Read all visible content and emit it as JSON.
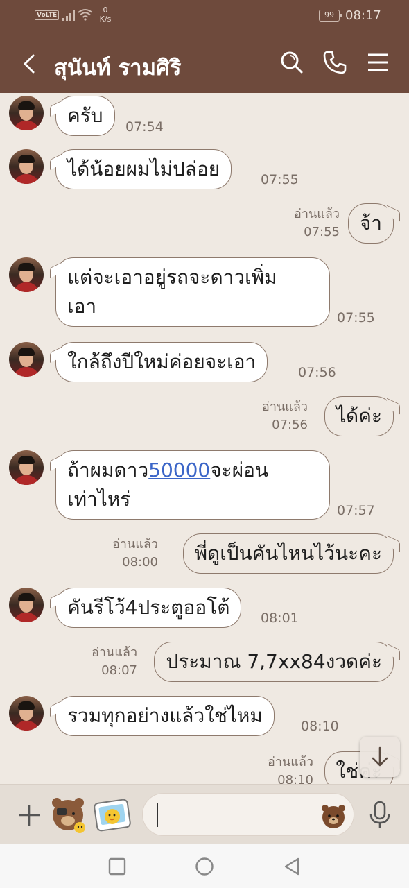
{
  "status_bar": {
    "volte": "VoLTE",
    "speed_value": "0",
    "speed_unit": "K/s",
    "battery": "99",
    "time": "08:17"
  },
  "header": {
    "title": "สุนันท์ รามศิริ",
    "icons": [
      "back-icon",
      "search-icon",
      "phone-icon",
      "menu-icon"
    ]
  },
  "messages": [
    {
      "side": "in",
      "text": "ครับ",
      "time": "07:54"
    },
    {
      "side": "in",
      "text": "ได้น้อยผมไม่ปล่อย",
      "time": "07:55"
    },
    {
      "side": "out",
      "text": "จ้า",
      "read": "อ่านแล้ว",
      "time": "07:55"
    },
    {
      "side": "in",
      "line1": "แต่จะเอาอยู่รถจะดาวเพิ่ม",
      "line2": "เอา",
      "time": "07:55"
    },
    {
      "side": "in",
      "text": "ใกล้ถึงปีใหม่ค่อยจะเอา",
      "time": "07:56"
    },
    {
      "side": "out",
      "text": "ได้ค่ะ",
      "read": "อ่านแล้ว",
      "time": "07:56"
    },
    {
      "side": "in",
      "pre": "ถ้าผมดาว",
      "link": "50000",
      "post": "จะผ่อน",
      "line2": "เท่าไหร่",
      "time": "07:57"
    },
    {
      "side": "out",
      "text": "พี่ดูเป็นคันไหนไว้นะคะ",
      "read": "อ่านแล้ว",
      "time": "08:00"
    },
    {
      "side": "in",
      "text": "คันรีโว้4ประตูออโต้",
      "time": "08:01"
    },
    {
      "side": "out",
      "text": "ประมาณ 7,7xx84งวดค่ะ",
      "read": "อ่านแล้ว",
      "time": "08:07"
    },
    {
      "side": "in",
      "text": "รวมทุกอย่างแล้วใช่ไหม",
      "time": "08:10"
    },
    {
      "side": "out",
      "text": "ใช่ค่ะ",
      "read": "อ่านแล้ว",
      "time": "08:10"
    }
  ],
  "input": {
    "placeholder": ""
  },
  "colors": {
    "header": "#6e4a3c",
    "chat_bg": "#efe9e2",
    "bubble_border": "#8e7a6d",
    "link": "#3c66c8"
  }
}
